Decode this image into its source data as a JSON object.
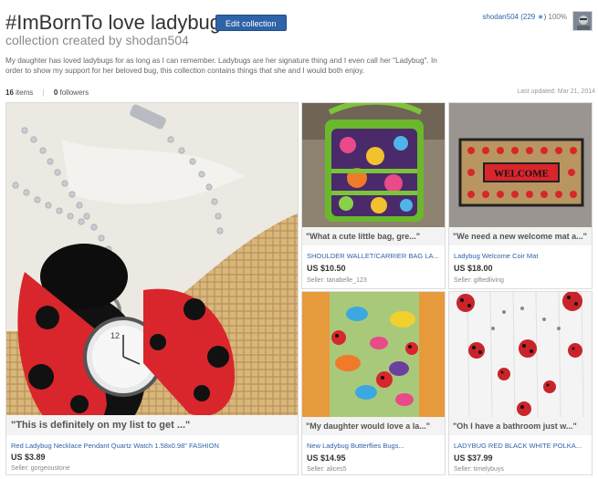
{
  "header": {
    "title": "#ImBornTo love ladybugs",
    "edit_label": "Edit collection",
    "subtitle": "collection created by shodan504"
  },
  "user": {
    "username": "shodan504",
    "score": "(229",
    "score_end": ")",
    "rating": "100%"
  },
  "description": "My daughter has loved ladybugs for as long as I can remember. Ladybugs are her signature thing and I even call her \"Ladybug\". In order to show my support for her beloved bug, this collection contains things that she and I would both enjoy.",
  "stats": {
    "items_count": "16",
    "items_label": "items",
    "followers_count": "0",
    "followers_label": "followers",
    "last_updated": "Last updated: Mar 21, 2014"
  },
  "items": [
    {
      "quote": "\"This is definitely on my list to get ...\"",
      "title": "Red Ladybug Necklace Pendant Quartz Watch 1.58x0.98\" FASHION",
      "price": "US $3.89",
      "seller": "Seller: gorgeoustone"
    },
    {
      "quote": "\"What a cute little bag, gre...\"",
      "title": "SHOULDER WALLET/CARRIER BAG LA...",
      "price": "US $10.50",
      "seller": "Seller: tanabelle_123"
    },
    {
      "quote": "\"We need a new welcome mat a...\"",
      "title": "Ladybug Welcome Coir Mat",
      "price": "US $18.00",
      "seller": "Seller: giftedliving",
      "mat_text": "WELCOME"
    },
    {
      "quote": "\"My daughter would love a la...\"",
      "title": "New Ladybug Butterflies Bugs...",
      "price": "US $14.95",
      "seller": "Seller: alices5"
    },
    {
      "quote": "\"Oh I have a bathroom just w...\"",
      "title": "LADYBUG RED BLACK WHITE POLKA...",
      "price": "US $37.99",
      "seller": "Seller: timelybuys"
    }
  ],
  "colors": {
    "link": "#2f63a8",
    "button": "#2f63a8",
    "ladybug_red": "#d8262c"
  }
}
